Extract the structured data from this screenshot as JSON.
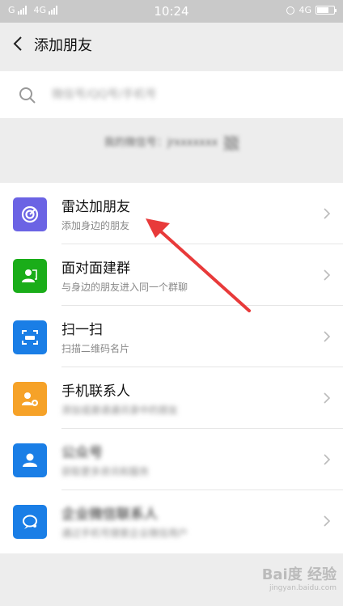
{
  "status_bar": {
    "carrier_1": "G",
    "carrier_2": "4G",
    "time": "10:24",
    "network_right": "4G",
    "battery_level": 0.7
  },
  "nav": {
    "title": "添加朋友",
    "back_icon": "chevron-left-icon"
  },
  "search": {
    "placeholder": "微信号/QQ号/手机号"
  },
  "my_id": {
    "text": "我的微信号：jrxxxxxxx"
  },
  "items": [
    {
      "title": "雷达加朋友",
      "subtitle": "添加身边的朋友",
      "icon": "radar-icon",
      "color": "#6b63e4"
    },
    {
      "title": "面对面建群",
      "subtitle": "与身边的朋友进入同一个群聊",
      "icon": "group-face-icon",
      "color": "#1aad19"
    },
    {
      "title": "扫一扫",
      "subtitle": "扫描二维码名片",
      "icon": "scan-icon",
      "color": "#1a7ee6"
    },
    {
      "title": "手机联系人",
      "subtitle": "添加或邀请通讯录中的朋友",
      "icon": "phone-contacts-icon",
      "color": "#f6a228"
    },
    {
      "title": "公众号",
      "subtitle": "获取更多资讯和服务",
      "icon": "official-account-icon",
      "color": "#1a7ee6"
    },
    {
      "title": "企业微信联系人",
      "subtitle": "通过手机号搜索企业微信用户",
      "icon": "enterprise-chat-icon",
      "color": "#1a7ee6"
    }
  ],
  "watermark": {
    "text": "Bai度 经验",
    "sub": "jingyan.baidu.com"
  }
}
